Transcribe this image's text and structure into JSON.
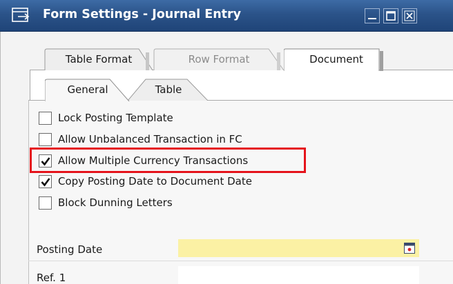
{
  "window": {
    "title": "Form Settings - Journal Entry",
    "title_icon": "form-arrow-icon",
    "buttons": [
      "minimize-icon",
      "maximize-icon",
      "close-icon"
    ]
  },
  "tabs": {
    "outer": [
      {
        "label": "Table Format",
        "state": "inactive"
      },
      {
        "label": "Row Format",
        "state": "disabled"
      },
      {
        "label": "Document",
        "state": "active"
      }
    ],
    "inner": [
      {
        "label": "General",
        "state": "active"
      },
      {
        "label": "Table",
        "state": "inactive"
      }
    ]
  },
  "checkboxes": [
    {
      "label": "Lock Posting Template",
      "checked": false
    },
    {
      "label": "Allow Unbalanced Transaction in FC",
      "checked": false
    },
    {
      "label": "Allow Multiple Currency Transactions",
      "checked": true,
      "highlighted": true
    },
    {
      "label": "Copy Posting Date to Document Date",
      "checked": true
    },
    {
      "label": "Block Dunning Letters",
      "checked": false
    }
  ],
  "fields": {
    "posting_date": {
      "label": "Posting Date",
      "value": "",
      "icon": "calendar-icon"
    },
    "ref1": {
      "label": "Ref. 1",
      "value": ""
    }
  },
  "colors": {
    "titlebar": "#2b5389",
    "highlight": "#e5131b",
    "mandatory_field": "#fbf1a4"
  }
}
